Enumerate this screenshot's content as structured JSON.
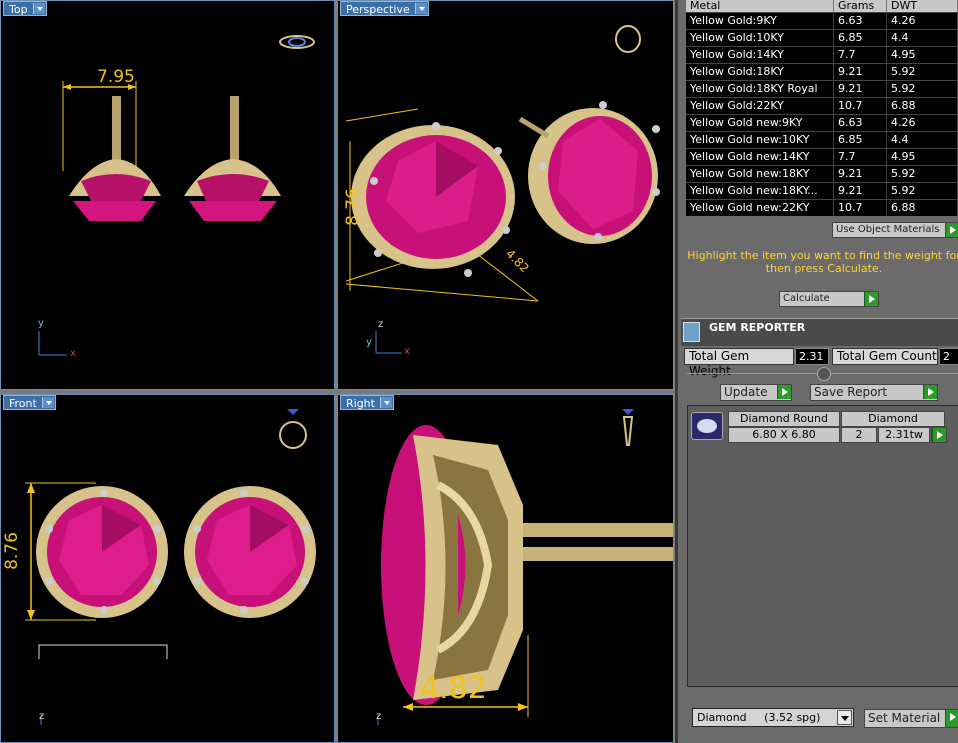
{
  "viewports": {
    "top": {
      "label": "Top",
      "dimension": "7.95"
    },
    "perspective": {
      "label": "Perspective",
      "dimension_a": "8.76",
      "dimension_b": "4.82"
    },
    "front": {
      "label": "Front",
      "dimension": "8.76"
    },
    "right": {
      "label": "Right",
      "dimension": "4.82"
    }
  },
  "axes": {
    "x": "x",
    "y": "y",
    "z": "z"
  },
  "materials_table": {
    "headers": [
      "Metal",
      "Grams",
      "DWT"
    ],
    "rows": [
      [
        "Yellow Gold:9KY",
        "6.63",
        "4.26"
      ],
      [
        "Yellow Gold:10KY",
        "6.85",
        "4.4"
      ],
      [
        "Yellow Gold:14KY",
        "7.7",
        "4.95"
      ],
      [
        "Yellow Gold:18KY",
        "9.21",
        "5.92"
      ],
      [
        "Yellow Gold:18KY Royal",
        "9.21",
        "5.92"
      ],
      [
        "Yellow Gold:22KY",
        "10.7",
        "6.88"
      ],
      [
        "Yellow Gold new:9KY",
        "6.63",
        "4.26"
      ],
      [
        "Yellow Gold new:10KY",
        "6.85",
        "4.4"
      ],
      [
        "Yellow Gold new:14KY",
        "7.7",
        "4.95"
      ],
      [
        "Yellow Gold new:18KY",
        "9.21",
        "5.92"
      ],
      [
        "Yellow Gold new:18KY...",
        "9.21",
        "5.92"
      ],
      [
        "Yellow Gold new:22KY",
        "10.7",
        "6.88"
      ]
    ]
  },
  "use_object_materials": "Use Object Materials",
  "hint": "Highlight the item you want to find the weight for then press Calculate.",
  "calculate_label": "Calculate",
  "gem_reporter": {
    "title": "GEM REPORTER",
    "total_weight_label": "Total Gem Weight",
    "total_weight_value": "2.31",
    "total_count_label": "Total Gem Count",
    "total_count_value": "2",
    "update_label": "Update",
    "save_report_label": "Save Report",
    "gems": [
      {
        "shape": "Diamond Round",
        "size": "6.80 X 6.80",
        "material": "Diamond",
        "count": "2",
        "weight": "2.31tw"
      }
    ]
  },
  "material_select": {
    "value": "Diamond",
    "density": "(3.52 spg)"
  },
  "set_material_label": "Set Material",
  "colors": {
    "gem": "#d4147f",
    "gold": "#d7c28a",
    "dimension": "#f2c21a",
    "accent_text": "#ffd23a"
  }
}
